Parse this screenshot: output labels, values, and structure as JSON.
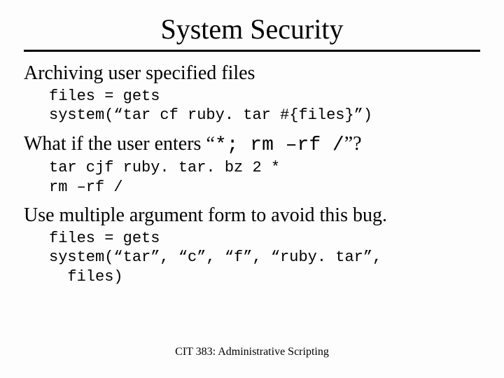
{
  "title": "System Security",
  "section1": {
    "heading": "Archiving user specified files",
    "code": "files = gets\nsystem(“tar cf ruby. tar #{files}”)"
  },
  "section2": {
    "heading_pre": "What if the user enters “",
    "heading_cmd": "*;  rm –rf /",
    "heading_post": "”?",
    "code": "tar cjf ruby. tar. bz 2 *\nrm –rf /"
  },
  "section3": {
    "heading": "Use multiple argument form to avoid this bug.",
    "code": "files = gets\nsystem(“tar”, “c”, “f”, “ruby. tar”,\n  files)"
  },
  "footer": "CIT 383: Administrative Scripting"
}
